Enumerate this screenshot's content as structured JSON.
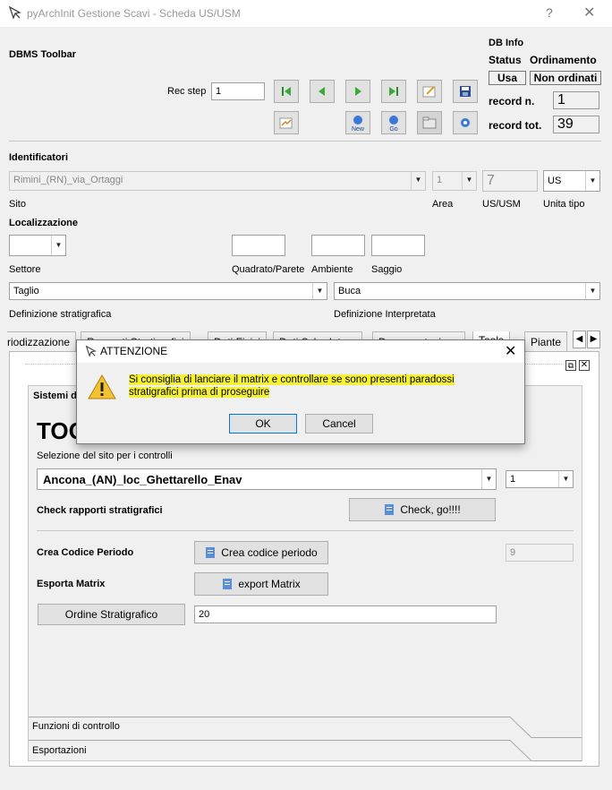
{
  "window": {
    "title": "pyArchInit Gestione Scavi - Scheda US/USM",
    "help": "?",
    "close": "✕"
  },
  "toolbar": {
    "title": "DBMS Toolbar",
    "rec_step_label": "Rec step",
    "rec_step_value": "1",
    "new_label": "New",
    "go_label": "Go"
  },
  "db_info": {
    "title": "DB Info",
    "status_label": "Status",
    "ordinamento_label": "Ordinamento",
    "status_value": "Usa",
    "ordinamento_value": "Non ordinati",
    "record_n_label": "record n.",
    "record_n_value": "1",
    "record_tot_label": "record tot.",
    "record_tot_value": "39"
  },
  "identificatori": {
    "title": "Identificatori",
    "sito_value": "Rimini_(RN)_via_Ortaggi",
    "sito_label": "Sito",
    "area_value": "1",
    "area_label": "Area",
    "us_value": "7",
    "us_label": "US/USM",
    "unita_tipo_value": "US",
    "unita_tipo_label": "Unita tipo"
  },
  "localizzazione": {
    "title": "Localizzazione",
    "settore_label": "Settore",
    "quadrato_label": "Quadrato/Parete",
    "ambiente_label": "Ambiente",
    "saggio_label": "Saggio",
    "def_strat_value": "Taglio",
    "def_strat_label": "Definizione stratigrafica",
    "def_interp_value": "Buca",
    "def_interp_label": "Definizione Interpretata"
  },
  "tabs": [
    "riodizzazione",
    "Rapporti Stratigrafici",
    "Dati Fisici",
    "Dati Schedatore",
    "Documentazione",
    "Tools",
    "Piante"
  ],
  "tools": {
    "group_title": "Sistemi di controllo",
    "heading": "TOOLS",
    "site_select_label": "Selezione del sito per i controlli",
    "site_value": "Ancona_(AN)_loc_Ghettarello_Enav",
    "site_num_value": "1",
    "check_label": "Check rapporti stratigrafici",
    "check_button": "Check, go!!!!",
    "crea_label": "Crea Codice Periodo",
    "crea_button": "Crea codice periodo",
    "crea_value": "9",
    "esporta_label": "Esporta Matrix",
    "esporta_button": "export Matrix",
    "ordine_button": "Ordine Stratigrafico",
    "ordine_value": "20",
    "toolbox_items": [
      "Funzioni di controllo",
      "Esportazioni"
    ]
  },
  "dialog": {
    "title": "ATTENZIONE",
    "message_line1": "Si consiglia di lanciare il matrix e controllare se sono presenti paradossi",
    "message_line2": "stratigrafici prima di proseguire",
    "ok": "OK",
    "cancel": "Cancel"
  },
  "colors": {
    "highlight": "#f5f236",
    "warning": "#f2c230",
    "nav_green": "#3aa83a",
    "save_blue": "#2a4c8c"
  }
}
